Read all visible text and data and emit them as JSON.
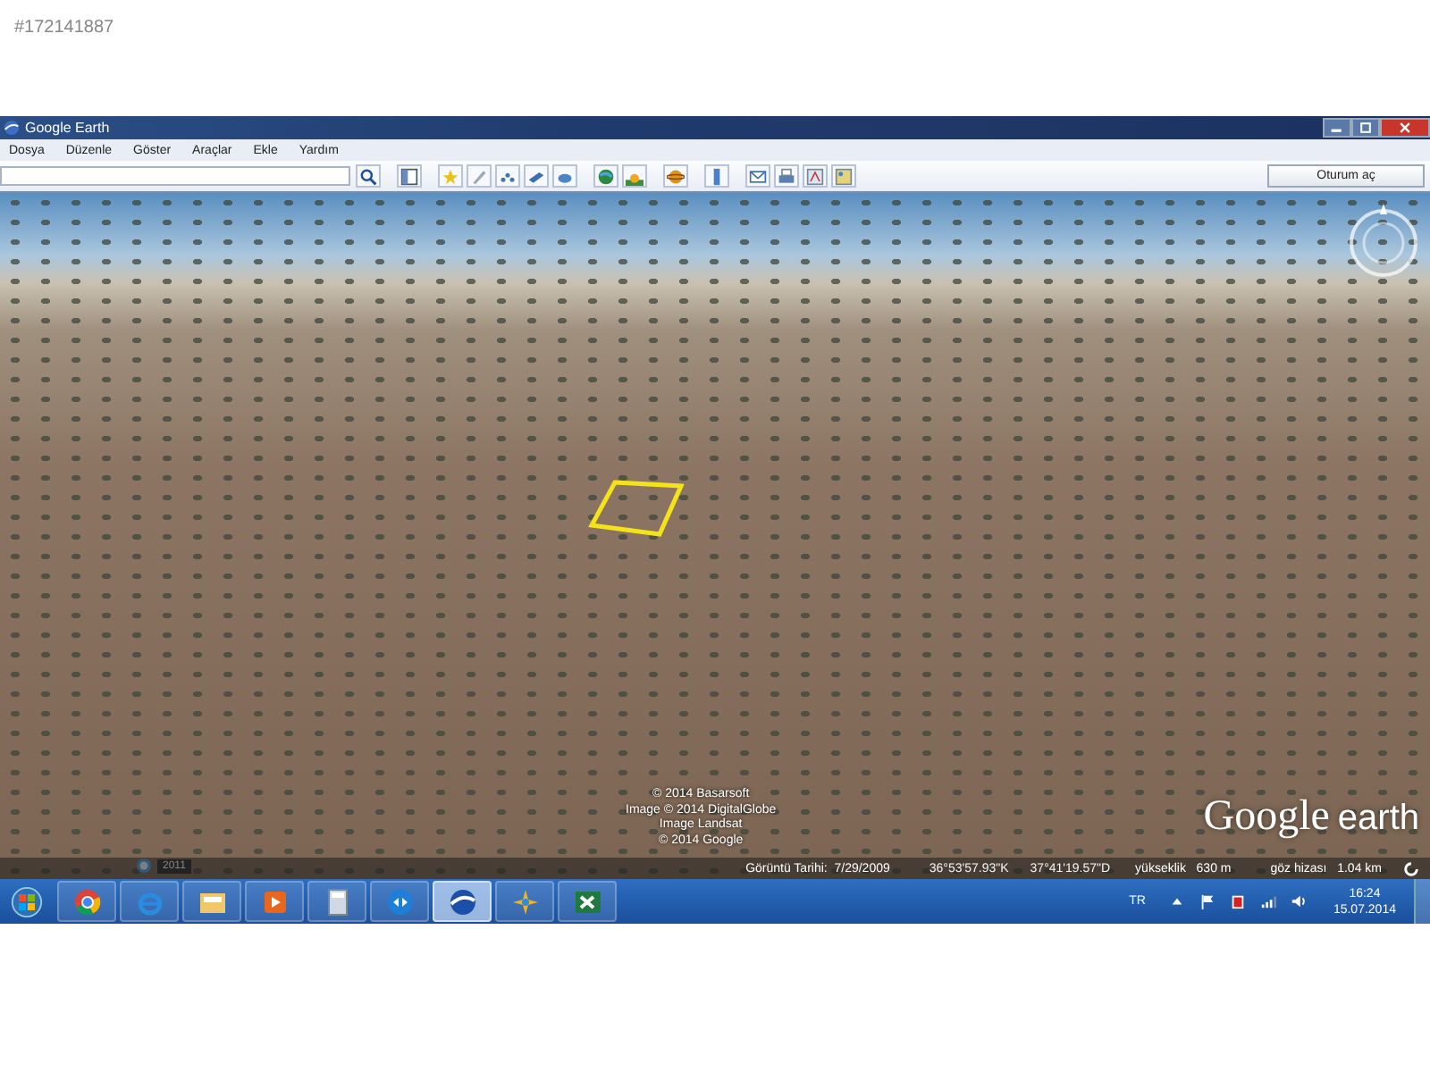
{
  "listing_id": "#172141887",
  "window": {
    "title": "Google Earth"
  },
  "menu": [
    "Dosya",
    "Düzenle",
    "Göster",
    "Araçlar",
    "Ekle",
    "Yardım"
  ],
  "toolbar": {
    "sign_in": "Oturum aç"
  },
  "map": {
    "historical_year": "2011",
    "attribution": [
      "© 2014 Basarsoft",
      "Image © 2014 DigitalGlobe",
      "Image Landsat",
      "© 2014 Google"
    ],
    "logo": {
      "brand": "Google",
      "product": "earth"
    },
    "status": [
      {
        "kind": "date",
        "text": "Görüntü Tarihi:  7/29/2009"
      },
      {
        "kind": "coord",
        "text": "36°53'57.93\"K"
      },
      {
        "kind": "coord",
        "text": "37°41'19.57\"D"
      },
      {
        "kind": "elevation",
        "text": "yükseklik   630 m"
      },
      {
        "kind": "eye",
        "text": "göz hizası   1.04 km"
      }
    ]
  },
  "taskbar": {
    "apps": [
      {
        "kind": "chrome",
        "selected": false
      },
      {
        "kind": "ie",
        "selected": false
      },
      {
        "kind": "folder",
        "selected": false
      },
      {
        "kind": "player",
        "selected": false
      },
      {
        "kind": "calculator",
        "selected": false
      },
      {
        "kind": "remote",
        "selected": false
      },
      {
        "kind": "earth",
        "selected": true
      },
      {
        "kind": "star",
        "selected": false
      },
      {
        "kind": "excel",
        "selected": false
      }
    ],
    "language": "TR",
    "time": "16:24",
    "date": "15.07.2014"
  }
}
